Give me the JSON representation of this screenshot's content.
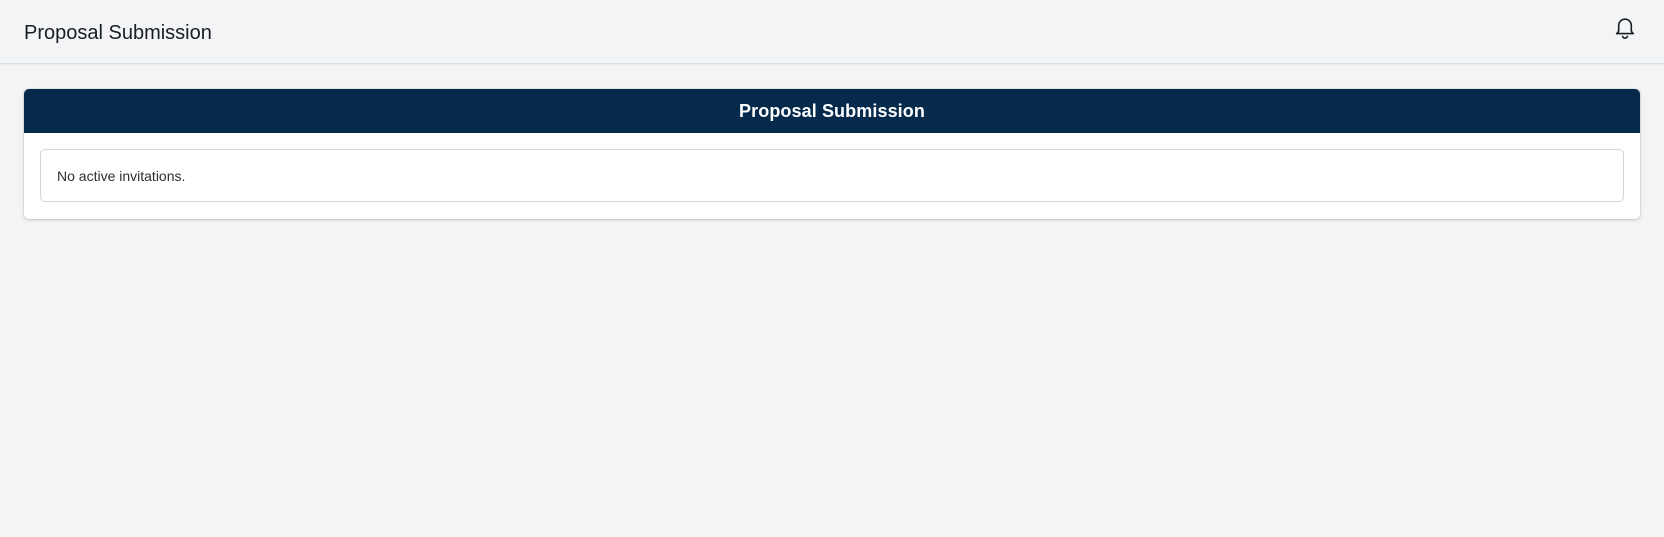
{
  "header": {
    "title": "Proposal Submission",
    "notification_icon": "bell-icon"
  },
  "card": {
    "title": "Proposal Submission",
    "empty_message": "No active invitations."
  },
  "colors": {
    "background": "#f3f4f6",
    "card_header": "#062a4c",
    "card_header_text": "#ffffff"
  }
}
